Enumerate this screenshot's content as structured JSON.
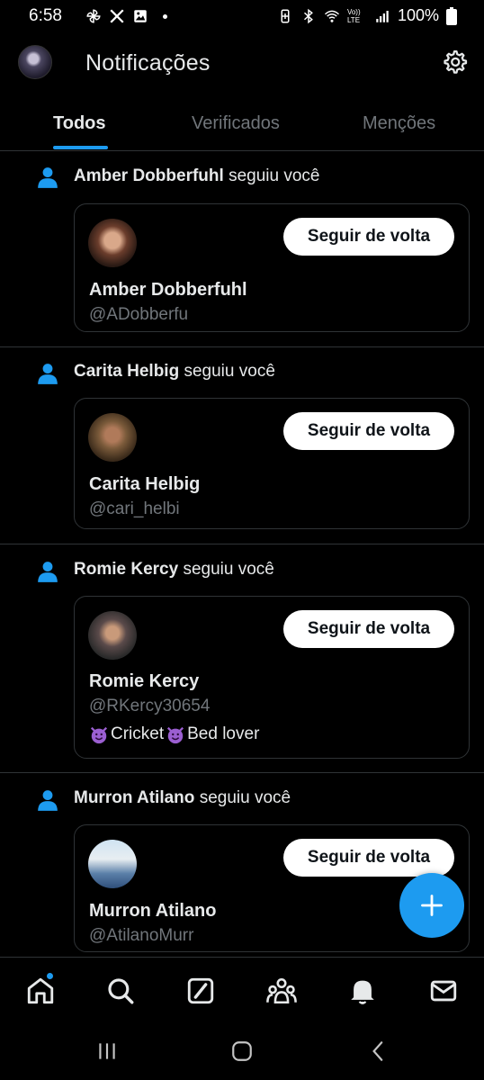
{
  "status_bar": {
    "time": "6:58",
    "left_icons": [
      "pinwheel-icon",
      "x-logo-icon",
      "image-icon",
      "dot-icon"
    ],
    "right_icons": [
      "battery-saver-icon",
      "bluetooth-icon",
      "wifi-icon",
      "volte-icon",
      "signal-icon",
      "battery-icon"
    ],
    "volte_text": "Vo)) LTE",
    "battery": "100%"
  },
  "header": {
    "title": "Notificações",
    "settings_icon": "gear-icon"
  },
  "tabs": [
    {
      "label": "Todos",
      "active": true
    },
    {
      "label": "Verificados",
      "active": false
    },
    {
      "label": "Menções",
      "active": false
    }
  ],
  "notifications": [
    {
      "actor": "Amber Dobberfuhl",
      "action": "seguiu você",
      "card": {
        "name": "Amber Dobberfuhl",
        "handle": "@ADobberfu",
        "bio": null,
        "button": "Seguir de volta"
      }
    },
    {
      "actor": "Carita Helbig",
      "action": "seguiu você",
      "card": {
        "name": "Carita Helbig",
        "handle": "@cari_helbi",
        "bio": null,
        "button": "Seguir de volta"
      }
    },
    {
      "actor": "Romie Kercy",
      "action": "seguiu você",
      "card": {
        "name": "Romie Kercy",
        "handle": "@RKercy30654",
        "bio": {
          "part1": "Cricket",
          "part2": "Bed lover"
        },
        "button": "Seguir de volta"
      }
    },
    {
      "actor": "Murron Atilano",
      "action": "seguiu você",
      "card": {
        "name": "Murron Atilano",
        "handle": "@AtilanoMurr",
        "bio": null,
        "button": "Seguir de volta"
      }
    }
  ],
  "fab": {
    "icon": "plus-icon"
  },
  "bottom_nav": [
    "home-icon",
    "search-icon",
    "grok-icon",
    "communities-icon",
    "notifications-bell-icon",
    "messages-icon"
  ],
  "system_nav": [
    "recents-icon",
    "home-circle-icon",
    "back-icon"
  ],
  "colors": {
    "accent": "#1d9bf0",
    "background": "#000000",
    "muted": "#71767b",
    "border": "#2f3336"
  }
}
